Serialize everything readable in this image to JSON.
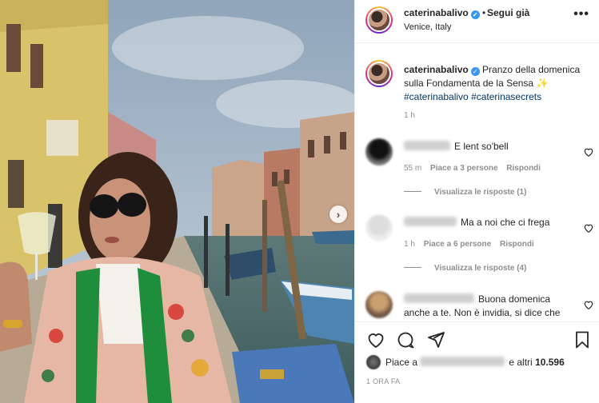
{
  "post": {
    "author": "caterinabalivo",
    "follow_label": "Segui già",
    "location": "Venice, Italy",
    "more_label": "•••",
    "verified_glyph": "✓"
  },
  "caption": {
    "username": "caterinabalivo",
    "text": "Pranzo della domenica sulla Fondamenta de la Sensa ✨",
    "hashtags": [
      "#caterinabalivo",
      "#caterinasecrets"
    ],
    "time": "1 h"
  },
  "comments": [
    {
      "text": "E lent so'bell",
      "time": "55 m",
      "likes": "Piace a 3 persone",
      "reply": "Rispondi",
      "view_replies": "Visualizza le risposte (1)"
    },
    {
      "text": "Ma a noi che ci frega",
      "time": "1 h",
      "likes": "Piace a 6 persone",
      "reply": "Rispondi",
      "view_replies": "Visualizza le risposte (4)"
    },
    {
      "text": "Buona domenica anche a te. Non è invidia, si dice che"
    }
  ],
  "likes": {
    "prefix": "Piace a",
    "suffix": "e altri",
    "count": "10.596"
  },
  "timestamp": "1 ORA FA",
  "icons": [
    "heart-icon",
    "comment-icon",
    "share-icon",
    "bookmark-icon",
    "verified-icon",
    "more-icon",
    "chevron-right-icon"
  ],
  "colors": {
    "link": "#00376b",
    "verified": "#3897f0",
    "muted": "#8e8e8e",
    "text": "#262626"
  }
}
